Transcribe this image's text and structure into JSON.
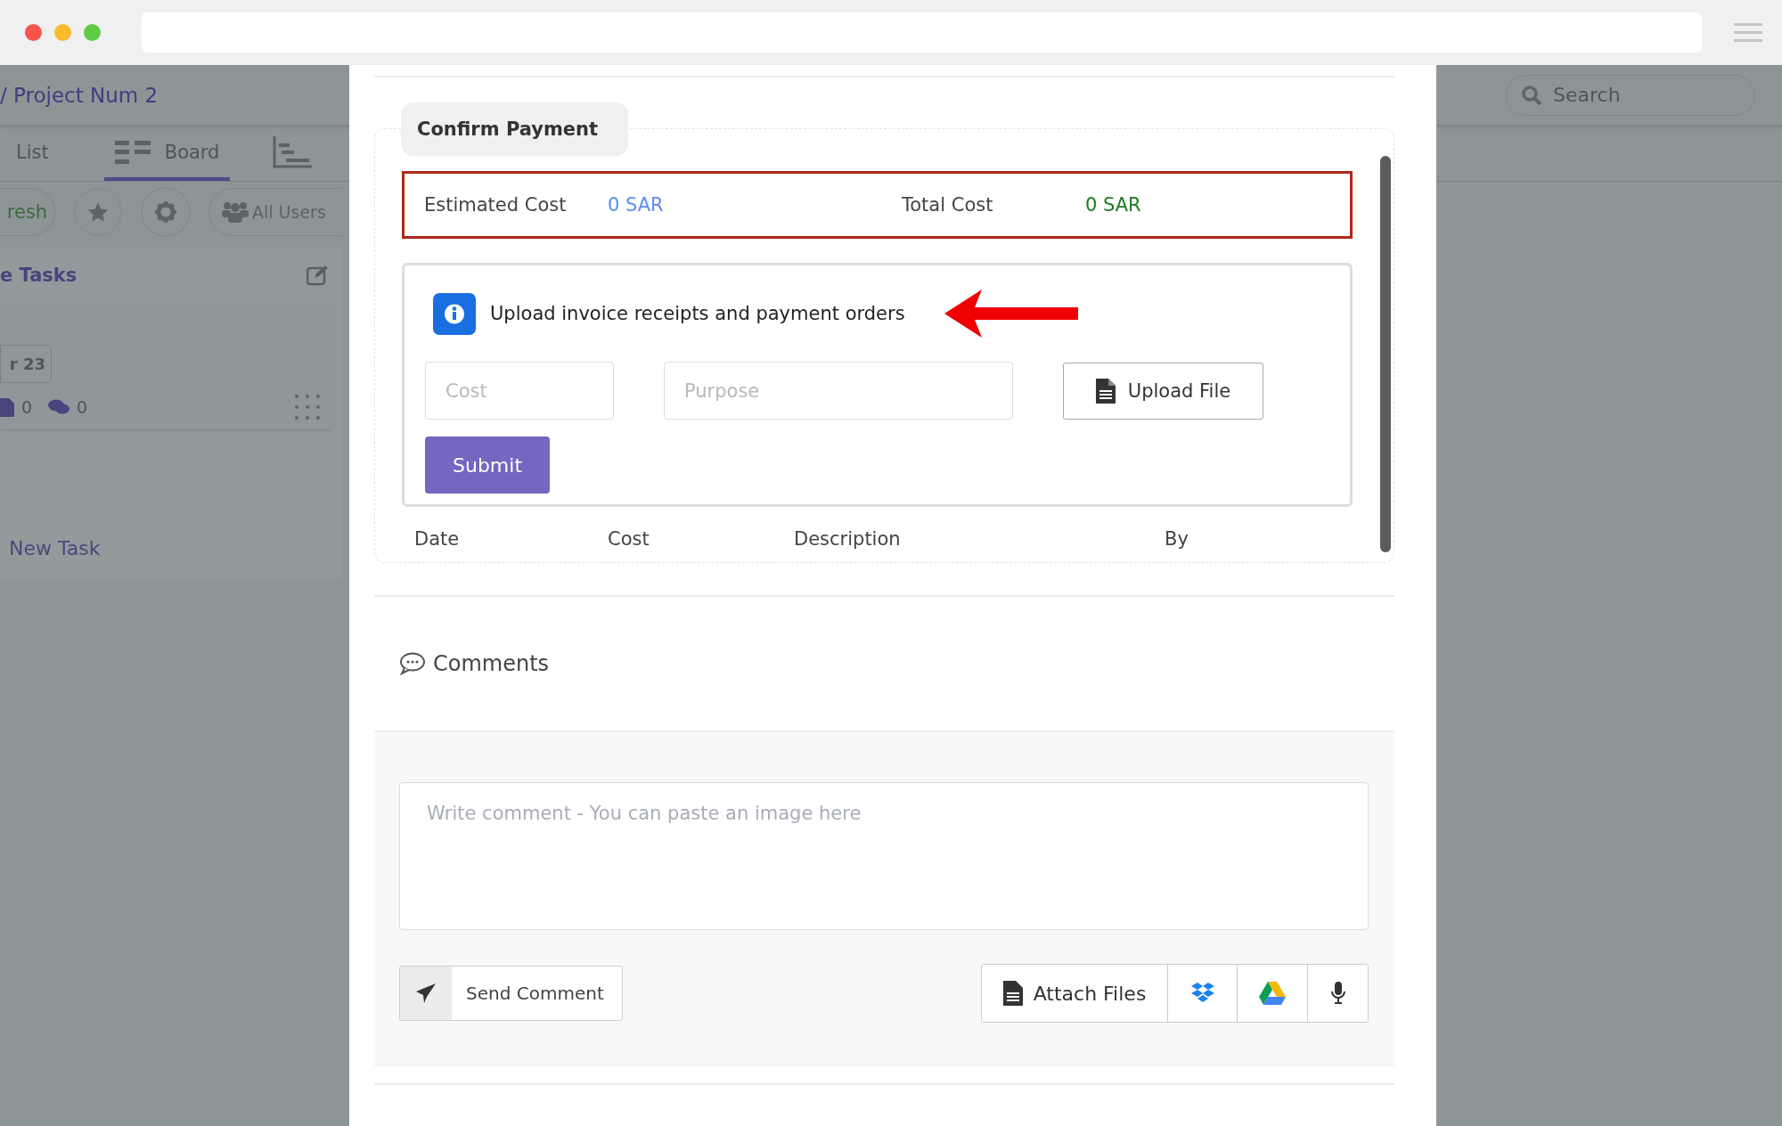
{
  "background": {
    "breadcrumb": "/ Project Num 2",
    "tabs": [
      {
        "label": "List",
        "selected": false
      },
      {
        "label": "Board",
        "selected": true
      }
    ],
    "toolbar": {
      "refresh_button": "resh",
      "users_button": "All Users"
    },
    "column": {
      "title": "e Tasks",
      "card": {
        "badge": "r 23",
        "files": "0",
        "comments": "0"
      },
      "add_task": "New Task"
    },
    "search": {
      "placeholder": "Search"
    }
  },
  "modal": {
    "section_tab": "Confirm Payment",
    "costs": [
      {
        "label": "Estimated Cost",
        "value": "0 SAR",
        "color": "#5b8def"
      },
      {
        "label": "Total Cost",
        "value": "0 SAR",
        "color": "#1f7a1f"
      }
    ],
    "notice": "Upload invoice receipts and payment orders",
    "fields": [
      {
        "placeholder": "Cost"
      },
      {
        "placeholder": "Purpose"
      }
    ],
    "upload_button": "Upload File",
    "submit_button": "Submit",
    "table": {
      "columns": [
        "Date",
        "Cost",
        "Description",
        "By"
      ]
    },
    "comments": {
      "title": "Comments",
      "placeholder": "Write comment - You can paste an image here",
      "send_button": "Send Comment",
      "attach_button": "Attach Files"
    }
  }
}
